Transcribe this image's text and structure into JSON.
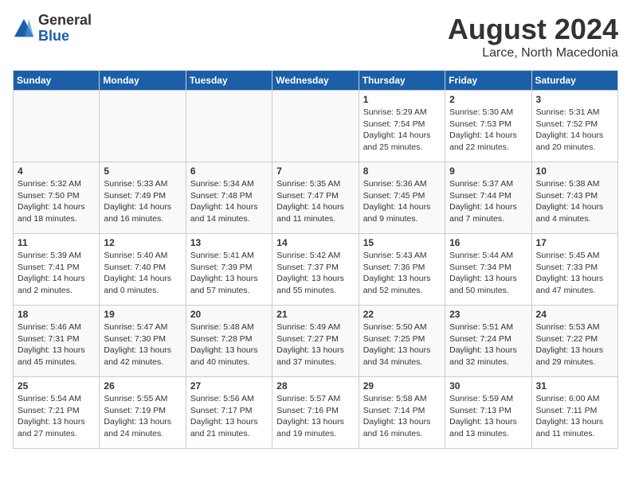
{
  "header": {
    "logo_general": "General",
    "logo_blue": "Blue",
    "main_title": "August 2024",
    "subtitle": "Larce, North Macedonia"
  },
  "days_of_week": [
    "Sunday",
    "Monday",
    "Tuesday",
    "Wednesday",
    "Thursday",
    "Friday",
    "Saturday"
  ],
  "weeks": [
    [
      {
        "day": "",
        "info": ""
      },
      {
        "day": "",
        "info": ""
      },
      {
        "day": "",
        "info": ""
      },
      {
        "day": "",
        "info": ""
      },
      {
        "day": "1",
        "info": "Sunrise: 5:29 AM\nSunset: 7:54 PM\nDaylight: 14 hours\nand 25 minutes."
      },
      {
        "day": "2",
        "info": "Sunrise: 5:30 AM\nSunset: 7:53 PM\nDaylight: 14 hours\nand 22 minutes."
      },
      {
        "day": "3",
        "info": "Sunrise: 5:31 AM\nSunset: 7:52 PM\nDaylight: 14 hours\nand 20 minutes."
      }
    ],
    [
      {
        "day": "4",
        "info": "Sunrise: 5:32 AM\nSunset: 7:50 PM\nDaylight: 14 hours\nand 18 minutes."
      },
      {
        "day": "5",
        "info": "Sunrise: 5:33 AM\nSunset: 7:49 PM\nDaylight: 14 hours\nand 16 minutes."
      },
      {
        "day": "6",
        "info": "Sunrise: 5:34 AM\nSunset: 7:48 PM\nDaylight: 14 hours\nand 14 minutes."
      },
      {
        "day": "7",
        "info": "Sunrise: 5:35 AM\nSunset: 7:47 PM\nDaylight: 14 hours\nand 11 minutes."
      },
      {
        "day": "8",
        "info": "Sunrise: 5:36 AM\nSunset: 7:45 PM\nDaylight: 14 hours\nand 9 minutes."
      },
      {
        "day": "9",
        "info": "Sunrise: 5:37 AM\nSunset: 7:44 PM\nDaylight: 14 hours\nand 7 minutes."
      },
      {
        "day": "10",
        "info": "Sunrise: 5:38 AM\nSunset: 7:43 PM\nDaylight: 14 hours\nand 4 minutes."
      }
    ],
    [
      {
        "day": "11",
        "info": "Sunrise: 5:39 AM\nSunset: 7:41 PM\nDaylight: 14 hours\nand 2 minutes."
      },
      {
        "day": "12",
        "info": "Sunrise: 5:40 AM\nSunset: 7:40 PM\nDaylight: 14 hours\nand 0 minutes."
      },
      {
        "day": "13",
        "info": "Sunrise: 5:41 AM\nSunset: 7:39 PM\nDaylight: 13 hours\nand 57 minutes."
      },
      {
        "day": "14",
        "info": "Sunrise: 5:42 AM\nSunset: 7:37 PM\nDaylight: 13 hours\nand 55 minutes."
      },
      {
        "day": "15",
        "info": "Sunrise: 5:43 AM\nSunset: 7:36 PM\nDaylight: 13 hours\nand 52 minutes."
      },
      {
        "day": "16",
        "info": "Sunrise: 5:44 AM\nSunset: 7:34 PM\nDaylight: 13 hours\nand 50 minutes."
      },
      {
        "day": "17",
        "info": "Sunrise: 5:45 AM\nSunset: 7:33 PM\nDaylight: 13 hours\nand 47 minutes."
      }
    ],
    [
      {
        "day": "18",
        "info": "Sunrise: 5:46 AM\nSunset: 7:31 PM\nDaylight: 13 hours\nand 45 minutes."
      },
      {
        "day": "19",
        "info": "Sunrise: 5:47 AM\nSunset: 7:30 PM\nDaylight: 13 hours\nand 42 minutes."
      },
      {
        "day": "20",
        "info": "Sunrise: 5:48 AM\nSunset: 7:28 PM\nDaylight: 13 hours\nand 40 minutes."
      },
      {
        "day": "21",
        "info": "Sunrise: 5:49 AM\nSunset: 7:27 PM\nDaylight: 13 hours\nand 37 minutes."
      },
      {
        "day": "22",
        "info": "Sunrise: 5:50 AM\nSunset: 7:25 PM\nDaylight: 13 hours\nand 34 minutes."
      },
      {
        "day": "23",
        "info": "Sunrise: 5:51 AM\nSunset: 7:24 PM\nDaylight: 13 hours\nand 32 minutes."
      },
      {
        "day": "24",
        "info": "Sunrise: 5:53 AM\nSunset: 7:22 PM\nDaylight: 13 hours\nand 29 minutes."
      }
    ],
    [
      {
        "day": "25",
        "info": "Sunrise: 5:54 AM\nSunset: 7:21 PM\nDaylight: 13 hours\nand 27 minutes."
      },
      {
        "day": "26",
        "info": "Sunrise: 5:55 AM\nSunset: 7:19 PM\nDaylight: 13 hours\nand 24 minutes."
      },
      {
        "day": "27",
        "info": "Sunrise: 5:56 AM\nSunset: 7:17 PM\nDaylight: 13 hours\nand 21 minutes."
      },
      {
        "day": "28",
        "info": "Sunrise: 5:57 AM\nSunset: 7:16 PM\nDaylight: 13 hours\nand 19 minutes."
      },
      {
        "day": "29",
        "info": "Sunrise: 5:58 AM\nSunset: 7:14 PM\nDaylight: 13 hours\nand 16 minutes."
      },
      {
        "day": "30",
        "info": "Sunrise: 5:59 AM\nSunset: 7:13 PM\nDaylight: 13 hours\nand 13 minutes."
      },
      {
        "day": "31",
        "info": "Sunrise: 6:00 AM\nSunset: 7:11 PM\nDaylight: 13 hours\nand 11 minutes."
      }
    ]
  ]
}
